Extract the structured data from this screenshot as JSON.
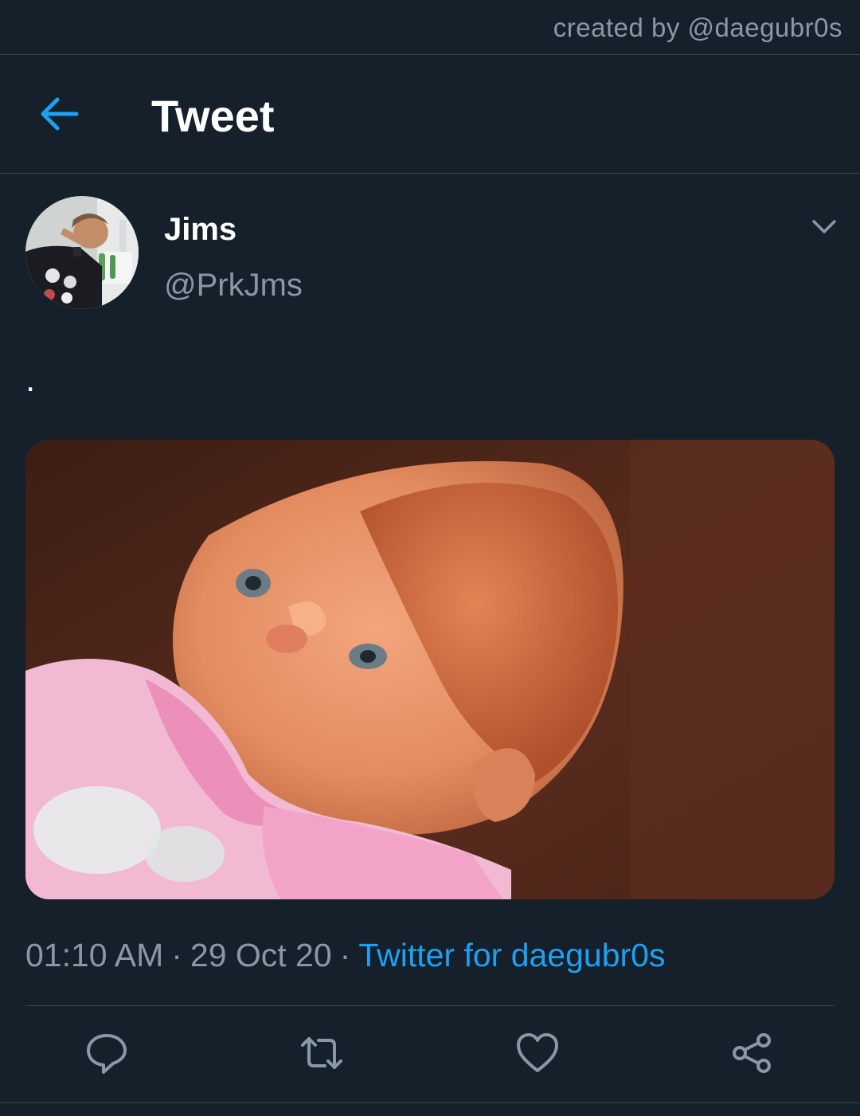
{
  "watermark": {
    "text": "created by @daegubr0s"
  },
  "header": {
    "title": "Tweet",
    "back_icon": "arrow-left-icon"
  },
  "tweet": {
    "author": {
      "name": "Jims",
      "handle": "@PrkJms"
    },
    "text": ".",
    "menu_icon": "chevron-down-icon",
    "media": {
      "type": "photo"
    },
    "time": "01:10 AM",
    "date": "29 Oct 20",
    "separator": "·",
    "source": "Twitter for daegubr0s"
  },
  "actions": [
    {
      "name": "reply",
      "icon": "reply-icon"
    },
    {
      "name": "retweet",
      "icon": "retweet-icon"
    },
    {
      "name": "like",
      "icon": "heart-icon"
    },
    {
      "name": "share",
      "icon": "share-icon"
    }
  ],
  "colors": {
    "background": "#15202b",
    "border": "#38444d",
    "accent": "#1da1f2",
    "secondary_text": "#8899a6",
    "icon": "#8899a6"
  }
}
